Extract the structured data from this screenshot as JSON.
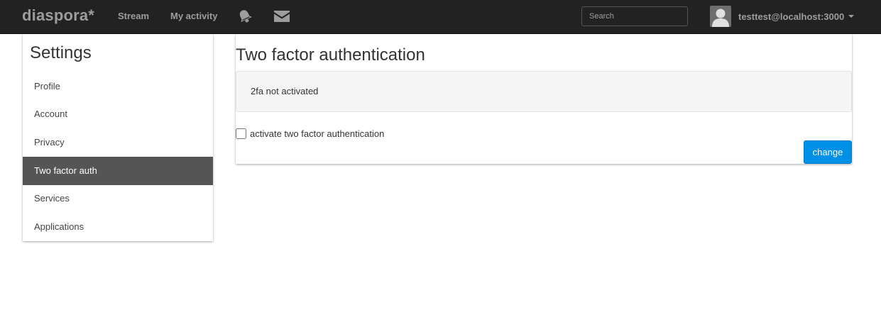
{
  "navbar": {
    "brand": "diaspora*",
    "links": [
      {
        "label": "Stream"
      },
      {
        "label": "My activity"
      }
    ],
    "icons": {
      "notifications": "bell-icon",
      "conversations": "envelope-icon"
    },
    "search": {
      "placeholder": "Search",
      "value": ""
    },
    "user": {
      "name": "testtest@localhost:3000",
      "avatar": "default-avatar-silhouette"
    }
  },
  "sidebar": {
    "title": "Settings",
    "items": [
      {
        "label": "Profile",
        "active": false
      },
      {
        "label": "Account",
        "active": false
      },
      {
        "label": "Privacy",
        "active": false
      },
      {
        "label": "Two factor auth",
        "active": true
      },
      {
        "label": "Services",
        "active": false
      },
      {
        "label": "Applications",
        "active": false
      }
    ]
  },
  "main": {
    "title": "Two factor authentication",
    "status": "2fa not activated",
    "checkbox": {
      "label": "activate two factor authentication",
      "checked": false
    },
    "submit_label": "change"
  },
  "colors": {
    "navbar_bg": "#222222",
    "navbar_text": "#9d9d9d",
    "active_item_bg": "#555555",
    "button_primary": "#0090e8",
    "well_bg": "#f5f5f5"
  }
}
